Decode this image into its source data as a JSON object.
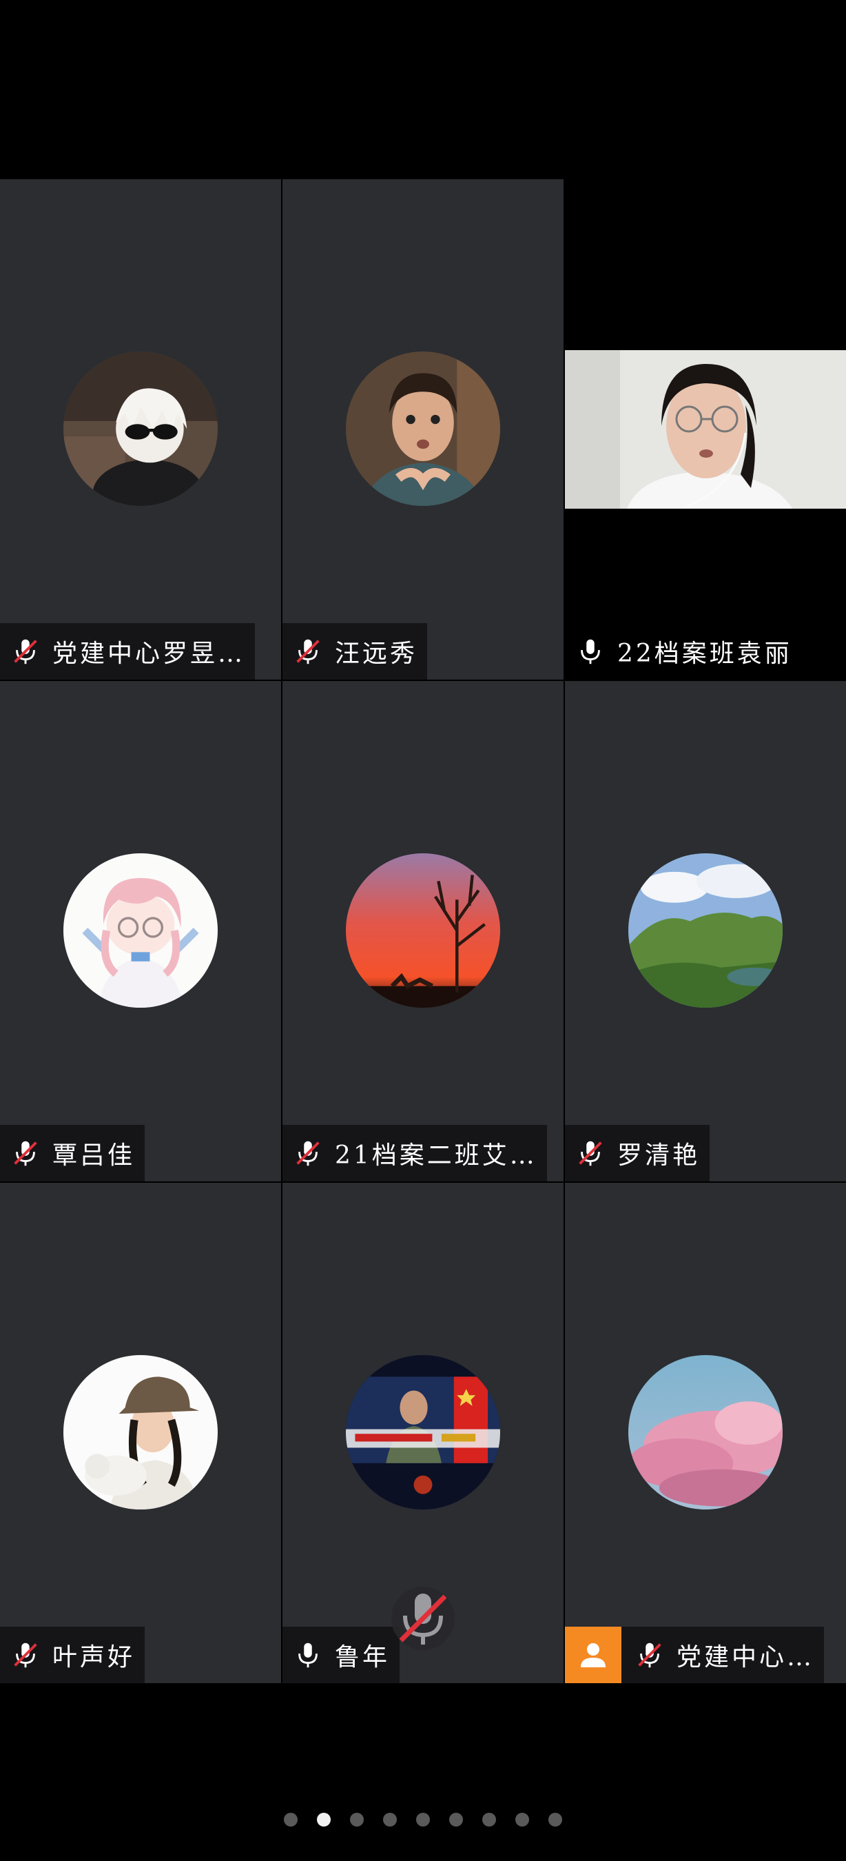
{
  "participants": [
    {
      "name": "党建中心罗昱…",
      "mic": "muted",
      "avatar": "avatar-anime-sunglasses"
    },
    {
      "name": "汪远秀",
      "mic": "muted",
      "avatar": "avatar-man-portrait"
    },
    {
      "name": "22档案班袁丽",
      "mic": "on",
      "avatar": "live-video-feed"
    },
    {
      "name": "覃吕佳",
      "mic": "muted",
      "avatar": "avatar-anime-girl"
    },
    {
      "name": "21档案二班艾…",
      "mic": "muted",
      "avatar": "avatar-sunset-tree"
    },
    {
      "name": "罗清艳",
      "mic": "muted",
      "avatar": "avatar-green-hills"
    },
    {
      "name": "叶声好",
      "mic": "muted",
      "avatar": "avatar-woman-hat"
    },
    {
      "name": "鲁年",
      "mic": "on",
      "avatar": "avatar-soldier-press"
    },
    {
      "name": "党建中心…",
      "mic": "muted",
      "avatar": "avatar-pink-clouds",
      "host": true
    }
  ],
  "pager": {
    "total": 9,
    "active_index": 1
  },
  "colors": {
    "tile_bg": "#2b2d31",
    "host_badge": "#f58a23",
    "muted_slash": "#e0303a",
    "dot_active": "#f2f2f2",
    "dot_inactive": "#5a5a5a"
  }
}
